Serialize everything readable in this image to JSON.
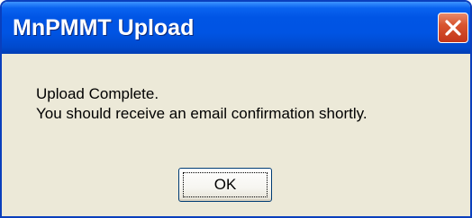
{
  "window": {
    "title": "MnPMMT Upload"
  },
  "titlebar": {
    "close_icon": "close-icon",
    "colors": {
      "titlebar_blue": "#0054e3",
      "close_red": "#d8552f",
      "dialog_background": "#ece9d8"
    }
  },
  "dialog": {
    "line1": "Upload Complete.",
    "line2": "You should receive an email confirmation shortly.",
    "ok_label": "OK"
  }
}
